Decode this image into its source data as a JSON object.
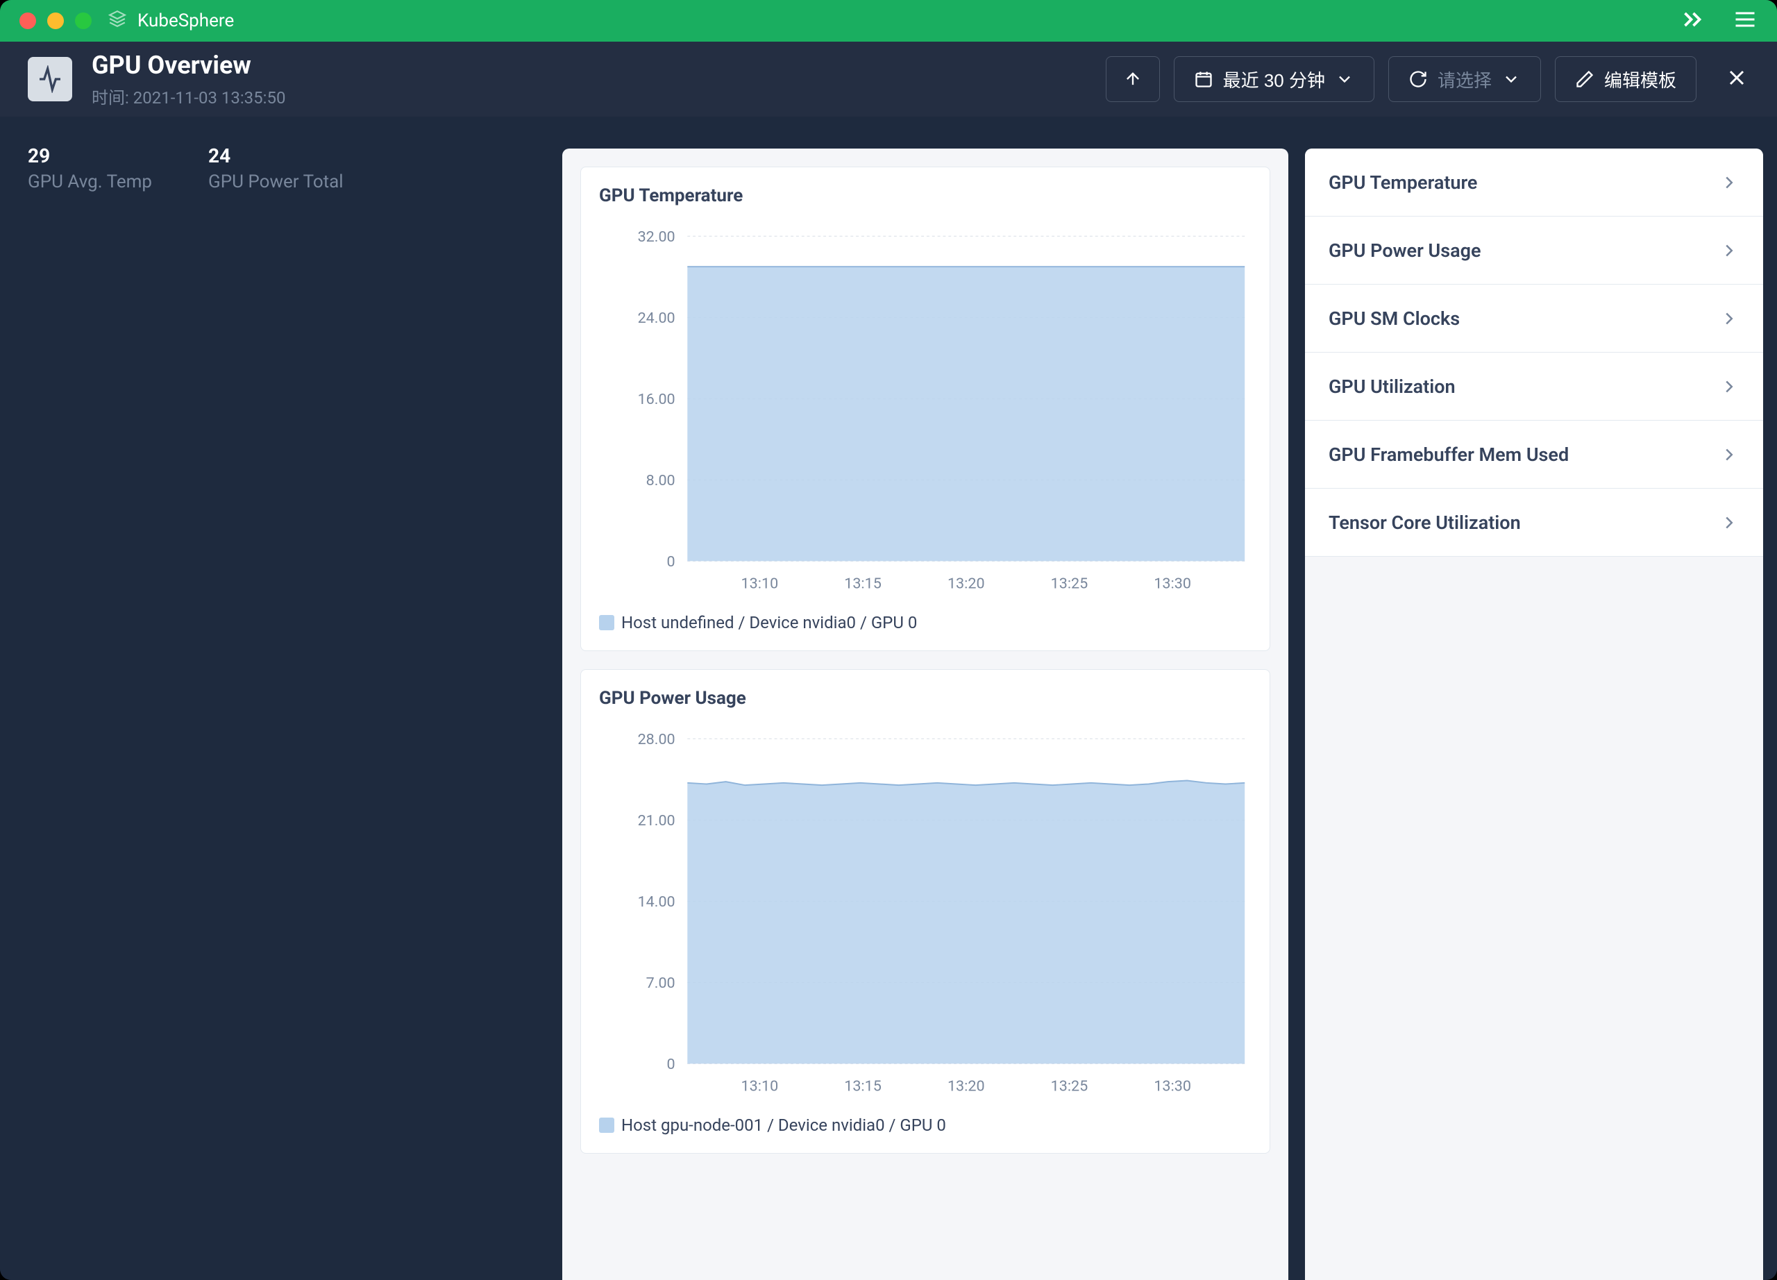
{
  "titlebar": {
    "app_name": "KubeSphere"
  },
  "header": {
    "title": "GPU Overview",
    "subtitle_prefix": "时间:",
    "subtitle_time": "2021-11-03 13:35:50",
    "time_range_label": "最近 30 分钟",
    "select_placeholder": "请选择",
    "edit_label": "编辑模板"
  },
  "stats": [
    {
      "value": "29",
      "label": "GPU Avg. Temp"
    },
    {
      "value": "24",
      "label": "GPU Power Total"
    }
  ],
  "nav_items": [
    "GPU Temperature",
    "GPU Power Usage",
    "GPU SM Clocks",
    "GPU Utilization",
    "GPU Framebuffer Mem Used",
    "Tensor Core Utilization"
  ],
  "chart_data": [
    {
      "type": "area",
      "title": "GPU Temperature",
      "ylabel": "",
      "ylim": [
        0,
        32
      ],
      "y_ticks": [
        0,
        8.0,
        16.0,
        24.0,
        32.0
      ],
      "x_ticks": [
        "13:10",
        "13:15",
        "13:20",
        "13:25",
        "13:30"
      ],
      "series": [
        {
          "name": "Host undefined / Device nvidia0 / GPU 0",
          "color": "#b7d2ed",
          "values": [
            29,
            29,
            29,
            29,
            29,
            29,
            29,
            29,
            29,
            29,
            29,
            29,
            29,
            29,
            29,
            29,
            29,
            29,
            29,
            29,
            29,
            29,
            29,
            29,
            29,
            29,
            29,
            29,
            29,
            29
          ]
        }
      ]
    },
    {
      "type": "area",
      "title": "GPU Power Usage",
      "ylabel": "",
      "ylim": [
        0,
        28
      ],
      "y_ticks": [
        0,
        7.0,
        14.0,
        21.0,
        28.0
      ],
      "x_ticks": [
        "13:10",
        "13:15",
        "13:20",
        "13:25",
        "13:30"
      ],
      "series": [
        {
          "name": "Host gpu-node-001 / Device nvidia0 / GPU 0",
          "color": "#b7d2ed",
          "values": [
            24.2,
            24.1,
            24.3,
            24.0,
            24.1,
            24.2,
            24.1,
            24.0,
            24.1,
            24.2,
            24.1,
            24.0,
            24.1,
            24.2,
            24.1,
            24.0,
            24.1,
            24.2,
            24.1,
            24.0,
            24.1,
            24.2,
            24.1,
            24.0,
            24.1,
            24.3,
            24.4,
            24.2,
            24.1,
            24.2
          ]
        }
      ]
    }
  ]
}
